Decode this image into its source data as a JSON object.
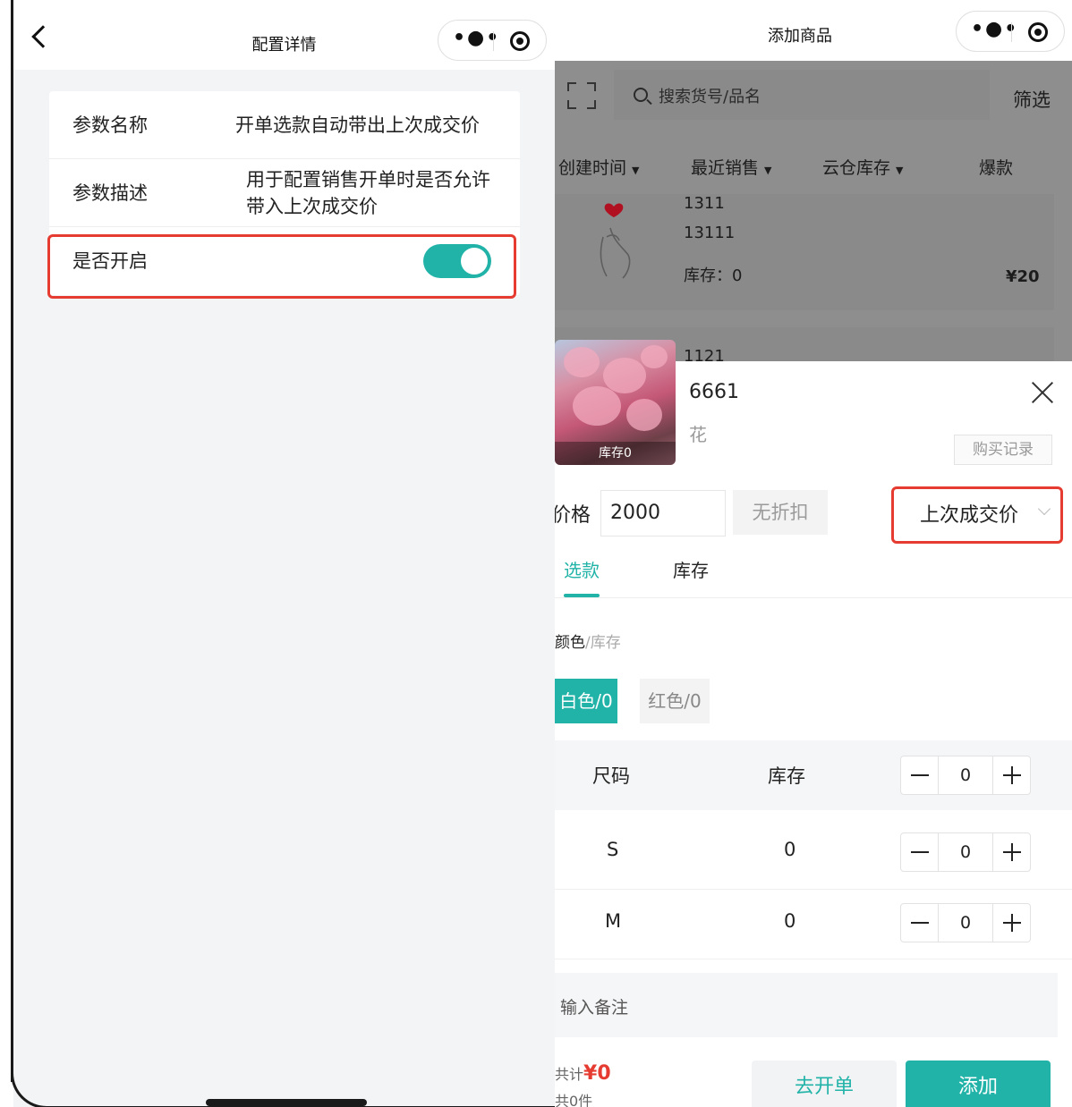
{
  "left": {
    "title": "配置详情",
    "rows": [
      {
        "key": "参数名称",
        "value": "开单选款自动带出上次成交价"
      },
      {
        "key": "参数描述",
        "value": "用于配置销售开单时是否允许带入上次成交价"
      },
      {
        "key": "是否开启",
        "toggle_on": true
      }
    ],
    "accent": "#21b3a8",
    "highlight_color": "#e63b30"
  },
  "right": {
    "title": "添加商品",
    "search_placeholder": "搜索货号/品名",
    "filter_label": "筛选",
    "sorts": [
      "创建时间",
      "最近销售",
      "云仓库存",
      "爆款"
    ],
    "list_item": {
      "line1": "1311",
      "line2": "13111",
      "stock": "库存：0",
      "price": "¥20"
    },
    "list_item2": {
      "line1": "1121"
    },
    "product": {
      "code": "6661",
      "name": "花",
      "thumb_caption": "库存0",
      "buy_record_label": "购买记录"
    },
    "price": {
      "label": "价格",
      "value": "2000",
      "discount_label": "无折扣",
      "mode": "上次成交价"
    },
    "tabs": [
      {
        "label": "选款",
        "active": true
      },
      {
        "label": "库存",
        "active": false
      }
    ],
    "color_label": "颜色",
    "color_sub": "/库存",
    "colors": [
      {
        "label": "白色/0",
        "selected": true
      },
      {
        "label": "红色/0",
        "selected": false
      }
    ],
    "grid_head": {
      "size": "尺码",
      "stock": "库存",
      "qty": "0"
    },
    "sizes": [
      {
        "size": "S",
        "stock": "0",
        "qty": "0"
      },
      {
        "size": "M",
        "stock": "0",
        "qty": "0"
      }
    ],
    "note_placeholder": "输入备注",
    "total_label": "共计",
    "total_value": "¥0",
    "qty_label": "共0件",
    "btn_go": "去开单",
    "btn_add": "添加"
  }
}
